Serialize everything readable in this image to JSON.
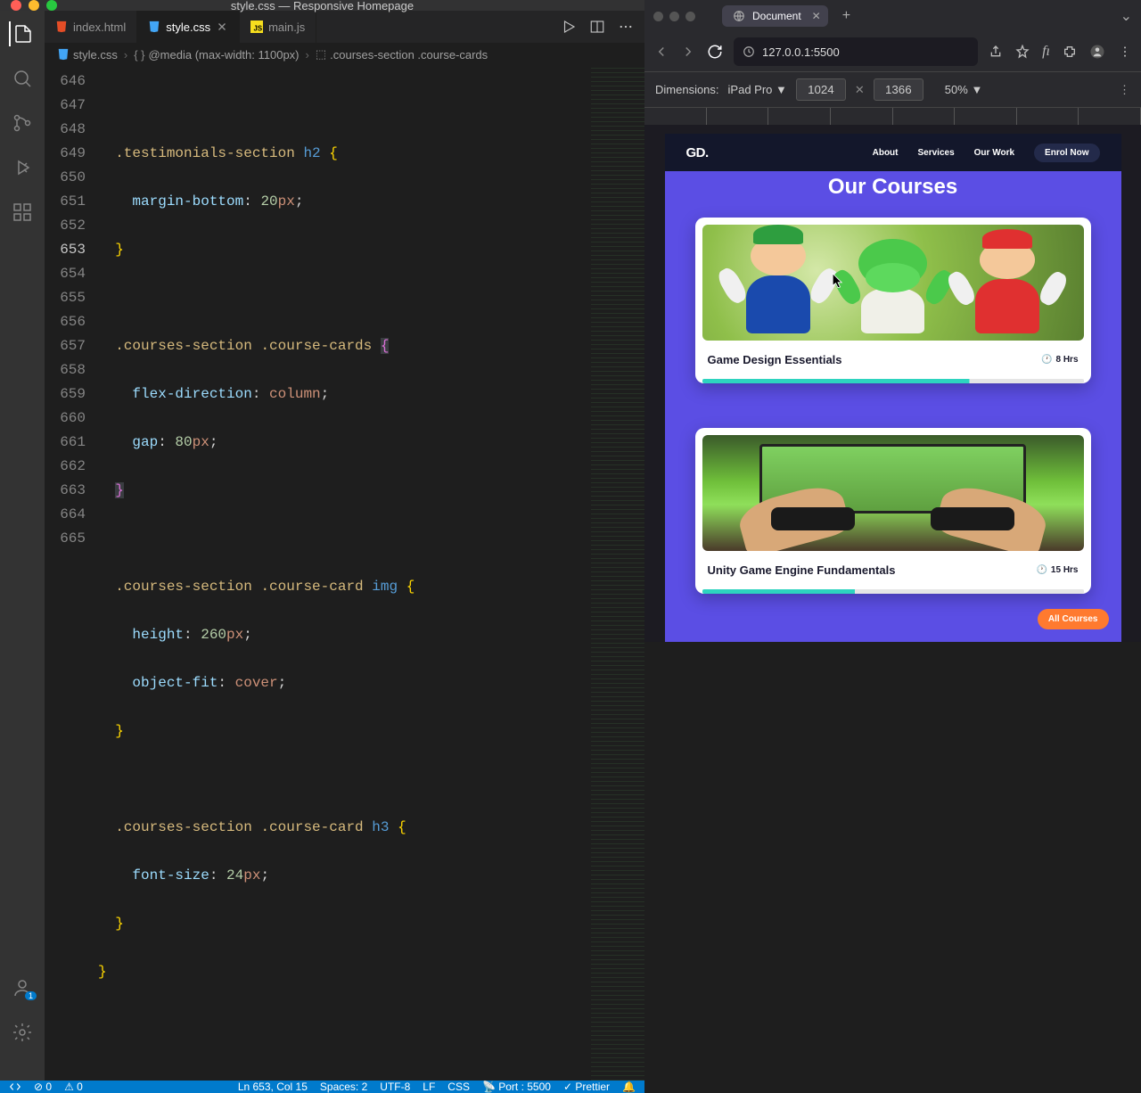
{
  "vscode": {
    "window_title": "style.css — Responsive Homepage",
    "tabs": [
      {
        "label": "index.html",
        "icon": "html"
      },
      {
        "label": "style.css",
        "icon": "css",
        "active": true
      },
      {
        "label": "main.js",
        "icon": "js"
      }
    ],
    "breadcrumb": {
      "file": "style.css",
      "media": "@media (max-width: 1100px)",
      "selector": ".courses-section .course-cards"
    },
    "code": {
      "lines": [
        {
          "n": 646,
          "raw": ""
        },
        {
          "n": 647,
          "raw": "  .testimonials-section h2 {"
        },
        {
          "n": 648,
          "raw": "    margin-bottom: 20px;"
        },
        {
          "n": 649,
          "raw": "  }"
        },
        {
          "n": 650,
          "raw": ""
        },
        {
          "n": 651,
          "raw": "  .courses-section .course-cards {"
        },
        {
          "n": 652,
          "raw": "    flex-direction: column;"
        },
        {
          "n": 653,
          "raw": "    gap: 80px;"
        },
        {
          "n": 654,
          "raw": "  }"
        },
        {
          "n": 655,
          "raw": ""
        },
        {
          "n": 656,
          "raw": "  .courses-section .course-card img {"
        },
        {
          "n": 657,
          "raw": "    height: 260px;"
        },
        {
          "n": 658,
          "raw": "    object-fit: cover;"
        },
        {
          "n": 659,
          "raw": "  }"
        },
        {
          "n": 660,
          "raw": ""
        },
        {
          "n": 661,
          "raw": "  .courses-section .course-card h3 {"
        },
        {
          "n": 662,
          "raw": "    font-size: 24px;"
        },
        {
          "n": 663,
          "raw": "  }"
        },
        {
          "n": 664,
          "raw": "}"
        },
        {
          "n": 665,
          "raw": ""
        }
      ],
      "current_line": 653
    },
    "status": {
      "errors": "0",
      "warnings": "0",
      "cursor": "Ln 653, Col 15",
      "spaces": "Spaces: 2",
      "encoding": "UTF-8",
      "eol": "LF",
      "lang": "CSS",
      "port": "Port : 5500",
      "prettier": "Prettier"
    }
  },
  "browser": {
    "tab_title": "Document",
    "url": "127.0.0.1:5500",
    "devtools": {
      "dimensions_label": "Dimensions:",
      "device": "iPad Pro",
      "width": "1024",
      "height": "1366",
      "zoom": "50%"
    }
  },
  "page": {
    "logo": "GD.",
    "nav": [
      "About",
      "Services",
      "Our Work"
    ],
    "cta": "Enrol Now",
    "section_title": "Our Courses",
    "cards": [
      {
        "title": "Game Design Essentials",
        "hours": "8 Hrs"
      },
      {
        "title": "Unity Game Engine Fundamentals",
        "hours": "15 Hrs"
      }
    ],
    "all_courses": "All Courses"
  }
}
